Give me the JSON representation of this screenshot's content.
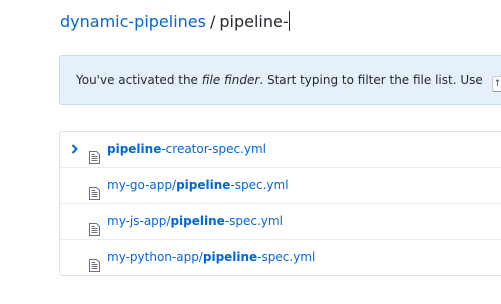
{
  "breadcrumb": {
    "repo": "dynamic-pipelines",
    "separator": "/",
    "filter": "pipeline-"
  },
  "flash": {
    "text_before": "You've activated the ",
    "emphasis": "file finder",
    "text_after": ". Start typing to filter the file list. Use ",
    "key": "↑"
  },
  "results": [
    {
      "prefix": "",
      "match": "pipeline",
      "suffix": "-creator-spec.yml",
      "selected": true
    },
    {
      "prefix": "my-go-app/",
      "match": "pipeline",
      "suffix": "-spec.yml",
      "selected": false
    },
    {
      "prefix": "my-js-app/",
      "match": "pipeline",
      "suffix": "-spec.yml",
      "selected": false
    },
    {
      "prefix": "my-python-app/",
      "match": "pipeline",
      "suffix": "-spec.yml",
      "selected": false
    }
  ],
  "icons": {
    "chevron": "chevron-right-icon",
    "file": "file-icon"
  },
  "colors": {
    "link": "#0366d6",
    "flash_bg": "#e5f0fb",
    "text": "#24292e"
  }
}
